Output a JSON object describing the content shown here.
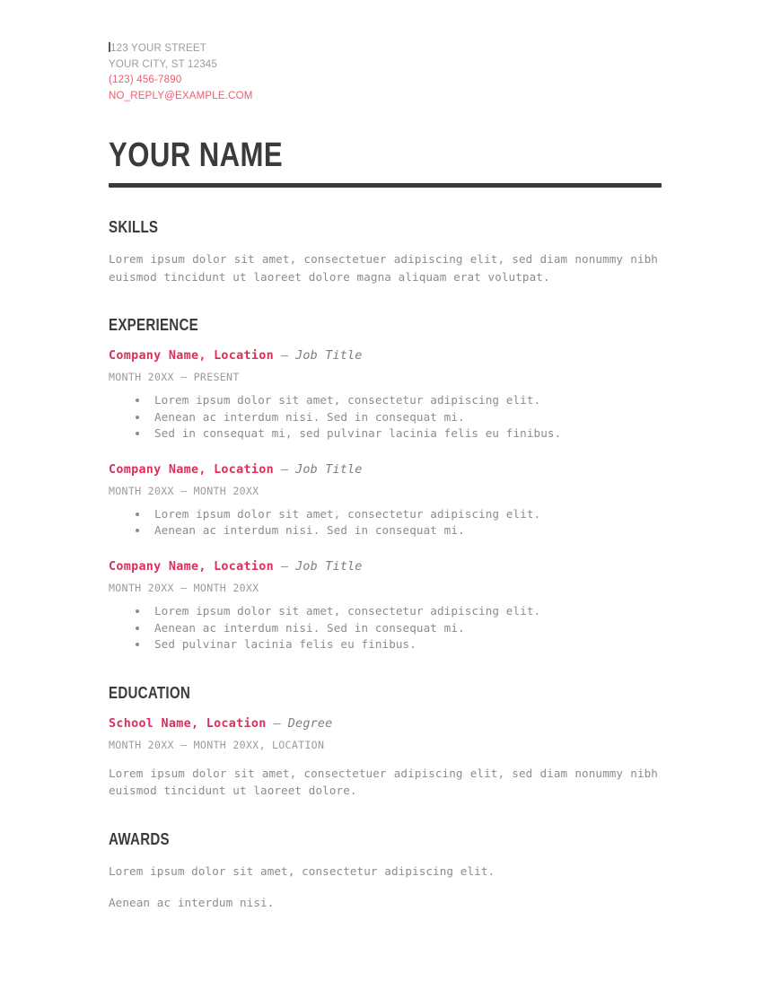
{
  "document": {
    "type": "resume",
    "accent_color": "#dc2f5e",
    "contact_color": "#ef5d6e",
    "heading_color": "#3b3b3b",
    "body_color": "#8c8c8c",
    "rule_color": "#3a3a3c"
  },
  "contact": {
    "street": "123 YOUR STREET",
    "city_state_zip": "YOUR CITY, ST 12345",
    "phone": "(123) 456-7890",
    "email": "NO_REPLY@EXAMPLE.COM"
  },
  "name": "YOUR NAME",
  "sections": {
    "skills": {
      "title": "SKILLS",
      "body": "Lorem ipsum dolor sit amet, consectetuer adipiscing elit, sed diam nonummy nibh euismod tincidunt ut laoreet dolore magna aliquam erat volutpat."
    },
    "experience": {
      "title": "EXPERIENCE",
      "entries": [
        {
          "org": "Company Name, Location",
          "separator": "–",
          "role": "Job Title",
          "dates": "MONTH 20XX – PRESENT",
          "bullets": [
            "Lorem ipsum dolor sit amet, consectetur adipiscing elit.",
            "Aenean ac interdum nisi. Sed in consequat mi.",
            "Sed in consequat mi, sed pulvinar lacinia felis eu finibus."
          ]
        },
        {
          "org": "Company Name, Location",
          "separator": "–",
          "role": "Job Title",
          "dates": "MONTH 20XX – MONTH 20XX",
          "bullets": [
            "Lorem ipsum dolor sit amet, consectetur adipiscing elit.",
            "Aenean ac interdum nisi. Sed in consequat mi."
          ]
        },
        {
          "org": "Company Name, Location",
          "separator": "–",
          "role": "Job Title",
          "dates": "MONTH 20XX – MONTH 20XX",
          "bullets": [
            "Lorem ipsum dolor sit amet, consectetur adipiscing elit.",
            "Aenean ac interdum nisi. Sed in consequat mi.",
            "Sed pulvinar lacinia felis eu finibus."
          ]
        }
      ]
    },
    "education": {
      "title": "EDUCATION",
      "entry": {
        "org": "School Name, Location",
        "separator": "–",
        "role": "Degree",
        "dates": "MONTH 20XX – MONTH 20XX, LOCATION",
        "body": "Lorem ipsum dolor sit amet, consectetuer adipiscing elit, sed diam nonummy nibh euismod tincidunt ut laoreet dolore."
      }
    },
    "awards": {
      "title": "AWARDS",
      "lines": [
        "Lorem ipsum dolor sit amet, consectetur adipiscing elit.",
        "Aenean ac interdum nisi."
      ]
    }
  }
}
